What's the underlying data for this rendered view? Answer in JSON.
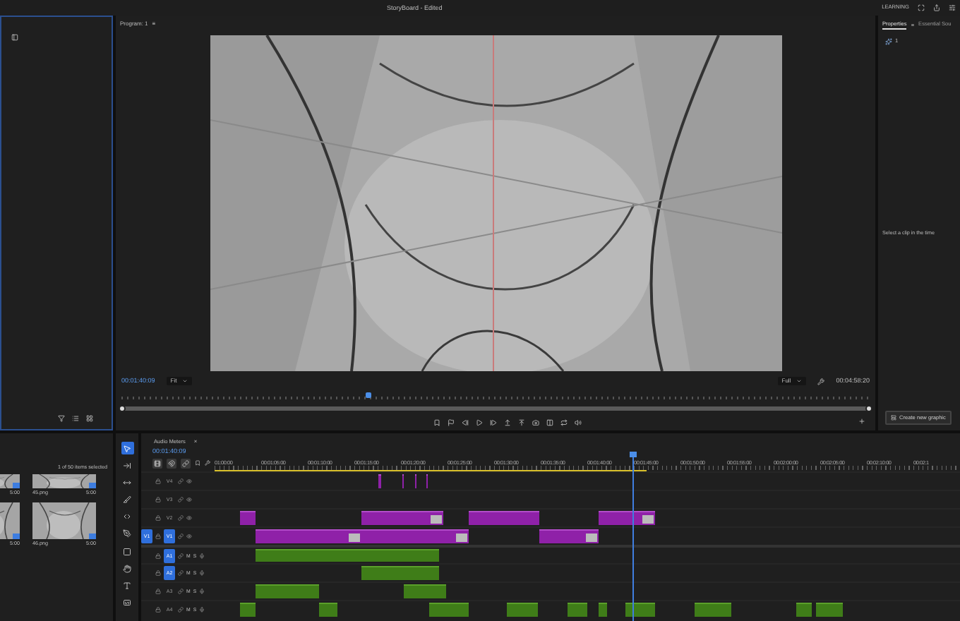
{
  "title_bar": {
    "title": "StoryBoard - Edited",
    "workspace": "LEARNING"
  },
  "program_monitor": {
    "tab": "Program: 1",
    "menu": "≡",
    "timecode": "00:01:40:09",
    "zoom": "Fit",
    "resolution": "Full",
    "duration": "00:04:58:20",
    "scrubber": {
      "level": 0.33
    }
  },
  "properties_panel": {
    "tabs": [
      {
        "label": "Properties",
        "selected": true
      },
      {
        "label": "Essential Sou",
        "selected": false
      }
    ],
    "menu": "≡",
    "count": "1",
    "message": "Select a clip in the time",
    "button": "Create new graphic"
  },
  "project_bin": {
    "status": "1 of 50 items selected",
    "items": [
      {
        "duration": "5:00"
      },
      {
        "name": "45.png",
        "duration": "5:00"
      },
      {
        "duration": "5:00"
      },
      {
        "name": "46.png",
        "duration": "5:00"
      }
    ]
  },
  "tools": [
    {
      "selected": true
    },
    {
      "selected": false
    },
    {
      "selected": false
    },
    {
      "selected": false
    },
    {
      "selected": false
    },
    {
      "selected": false
    },
    {
      "selected": false
    },
    {
      "selected": false
    },
    {
      "selected": false
    },
    {
      "selected": false
    }
  ],
  "timeline": {
    "tab": "Audio Meters",
    "close": "×",
    "timecode": "00:01:40:09",
    "playhead": {
      "level": 0.6
    },
    "ruler": [
      "01:00:00",
      "00:01:05:00",
      "00:01:10:00",
      "00:01:15:00",
      "00:01:20:00",
      "00:01:25:00",
      "00:01:30:00",
      "00:01:35:00",
      "00:01:40:00",
      "00:01:45:00",
      "00:01:50:00",
      "00:01:55:00",
      "00:02:00:00",
      "00:02:05:00",
      "00:02:10:00",
      "00:02:1"
    ],
    "tracks": [
      {
        "kind": "video",
        "label": "V4",
        "targeted": false
      },
      {
        "kind": "video",
        "label": "V3",
        "targeted": false
      },
      {
        "kind": "video",
        "label": "V2",
        "targeted": false
      },
      {
        "kind": "video",
        "label": "V1",
        "targeted": true,
        "source": "V1"
      },
      {
        "kind": "audio",
        "label": "A1",
        "targeted": true,
        "mute": "M",
        "solo": "S"
      },
      {
        "kind": "audio",
        "label": "A2",
        "targeted": true,
        "mute": "M",
        "solo": "S"
      },
      {
        "kind": "audio",
        "label": "A3",
        "targeted": false,
        "mute": "M",
        "solo": "S"
      },
      {
        "kind": "audio",
        "label": "A4",
        "targeted": false,
        "mute": "M",
        "solo": "S"
      }
    ]
  }
}
